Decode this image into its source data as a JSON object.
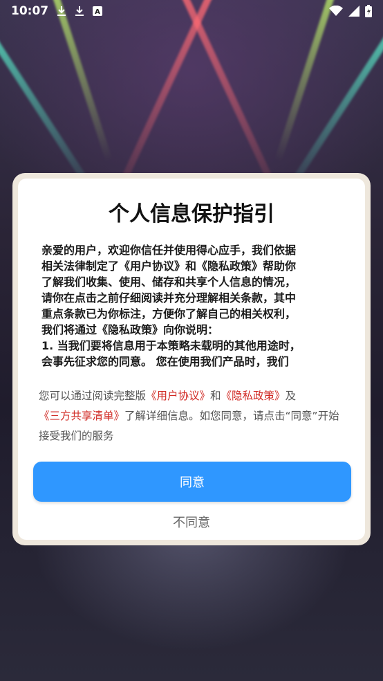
{
  "status_bar": {
    "time": "10:07",
    "notification_icons": [
      "download-icon",
      "download-icon",
      "font-a-icon"
    ],
    "system_icons": [
      "wifi-icon",
      "signal-icon",
      "battery-icon"
    ]
  },
  "dialog": {
    "title": "个人信息保护指引",
    "body_lines": [
      "亲爱的用户，欢迎你信任并使用得心应手，我们依据",
      "相关法律制定了《用户协议》和《隐私政策》帮助你",
      "了解我们收集、使用、储存和共享个人信息的情况，",
      "请你在点击之前仔细阅读并充分理解相关条款，其中",
      "重点条款已为你标注，方便你了解自己的相关权利，",
      "我们将通过《隐私政策》向你说明：",
      "1. 当我们要将信息用于本策略未载明的其他用途时，",
      "会事先征求您的同意。 您在使用我们产品时，我们"
    ],
    "notice": {
      "prefix": "您可以通过阅读完整版",
      "link_user_agreement": "《用户协议》",
      "and": "和",
      "link_privacy_policy": "《隐私政策》",
      "and2": "及",
      "link_third_party": "《三方共享清单》",
      "suffix": "了解详细信息。如您同意，请点击“同意”开始接受我们的服务"
    },
    "agree_label": "同意",
    "disagree_label": "不同意"
  },
  "colors": {
    "agree_button": "#2f97ff",
    "link": "#d12a24"
  }
}
